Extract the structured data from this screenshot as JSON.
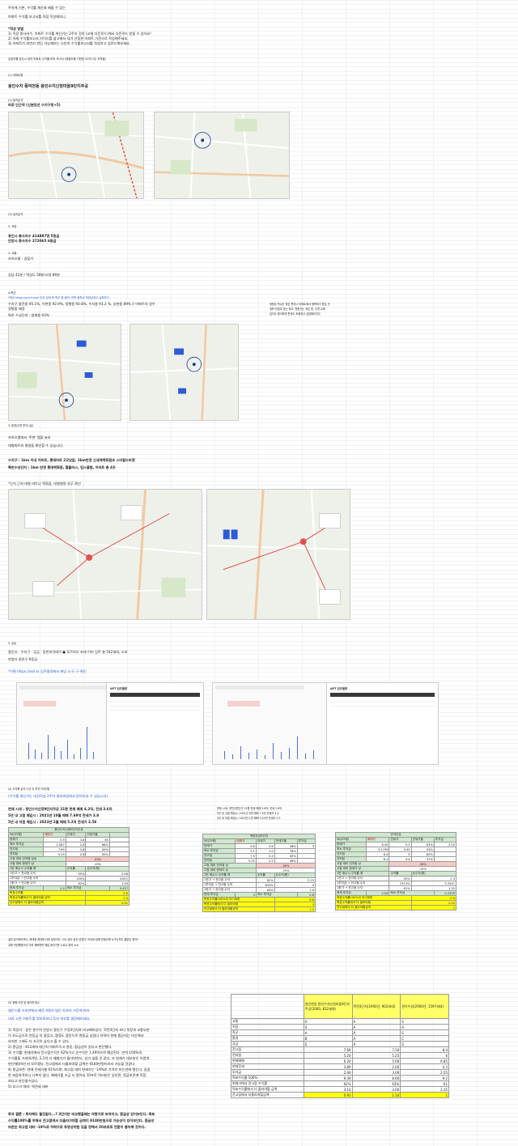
{
  "header": {
    "line1": "주차에 기본, 수익률 계산표 배울 수 있는",
    "line2": "아파트 수익률 보고서를 직접 작성해보니"
  },
  "rules": {
    "title": "*작성 방법",
    "r1": "1) 직장 종사자수, 아파트 수익률 계산기는 2주차 강의 (교재 다운로드)에서 다운로드 받을 수 있어요!",
    "r2": "2) 아래 수익률보고서 가이드를 참고해서 내가 선정한 아파트 기준으로 작성해주세요.",
    "r3": "3) 아파트가 비번지 판단 가능해보는 나만의 수익률보고서를 작성하고 업로드해보세요.",
    "note": "임장지를 앞두시 대자 아파트 수익률 보여 보고서 (정렬도를 기반한 20개 2주 지역별)"
  },
  "s1": {
    "tag": "(1) 아파트명",
    "name": "용인수지 풍덕천동 용인수지신정마을9단지주공"
  },
  "s2": {
    "tag": "(2) 위치분석",
    "line": "바로 인근역 (신분당선 수지구청+5)"
  },
  "s3": {
    "tag": "(3) 입지분석"
  },
  "s4": {
    "tag": "3. 직장",
    "l1": "용인시 총사자수 414887명 5등급",
    "l2": "안양시 종사자수 272065 6등급",
    "c": "2. 교통",
    "c2": "카카오맵 - 길찾기",
    "c3": "강남 42분 / 역삼도 58분/시청 86분"
  },
  "s5": {
    "tag": "4.학군",
    "link": "*학군 https://asil.kr/asil 단지 검색 후 학군 탭 클릭, 진학 중학교 학업성취도 살펴보기",
    "l1": "수지구 졸진중 95.1%, 이현중 92.9%, 정평중 92.8%, 수지중 91.2 %, 상현중 89% // 아파트의 경우",
    "l2": "정평중 배정",
    "l3": "특반 수성단지 : 범계중 93%",
    "side1": "정평은 학교는 좋은 편이나 아파트에서 왕복하기 좋은 곳",
    "side2": "생활 반경과 맞는 학교. 학원가는 적은 편. 주변 교육",
    "side3": "입지도 평이하며 편의도 조용하고 성장해보인다"
  },
  "s6": {
    "tag": "5. 환경(주변 편의시설)",
    "l1": "카카오맵에서 '주변' 탭을 눌러",
    "l2": "대형마트와 병원을 확인할 수 있습니다.",
    "l3": "수지구 : 1km 이내 이마트, 롯데마트 2곳있음, 2km반경 신세계백화점과 스타필드마켓",
    "l4": "특반수성단지 : 1km 반경 롯데백화점, 홈플러스, 킴스클럽, 이마트 총 4곳",
    "l5": "*단지 근처 대형 마트나 백화점, 대형병원 유무 확인"
  },
  "s7": {
    "tag": "5. 공급",
    "l1": "용인시 · 수지구 · 공급 · 동천지이데이 ● 푸르지오 포레 이미 입주 총 542세대, 소보",
    "l2": "안양시 동안구 6등급",
    "link": "*이편 https://asil.kr 입주물량에서 해당 시·도·구 확인"
  },
  "screens": {
    "t1": "APT 입주물량",
    "t2": "APT 입주물량"
  },
  "s8": {
    "tag": "(4) 수익률 분석 (1년 뒤 투자 가치/재)",
    "sub": "(수익률 계산기는 내강의실 2주차 첨부파일에서 받아보실 수 있습니다)",
    "l1": "현재 시세 : 용인수지신정9단지주공 21평 현재 매매 4.2억, 전세 3.6억",
    "l2": "5년 내 고점 매입시 : 2021년 10월 매매 7.69억 전세가 3.8",
    "l3": "5년 내 저점 매입시 : 2023년 2월 매매 5.2억 전세가 2.58",
    "side": "현재 시세: 부천신만단지 21평 현재 매매 5.6억, 전세 2.6억",
    "side2": "5년 내 고점 매입시: 2021년 9월 매매 7.5억 전세가 2.4",
    "side3": "5년 내 저점 매입시: 2023년 1월 매매 5.25억 전세가 2.5"
  },
  "tables": {
    "t1": {
      "title": "용인수지신정9단지주공",
      "h": [
        "58(25평)",
        "매매가",
        "전세가",
        "전세가율"
      ],
      "rows": [
        [
          "현재가",
          "5.9",
          "3.8",
          "65"
        ],
        [
          "최소 투자금",
          "2.087",
          "2.6",
          "86%"
        ],
        [
          "전고점",
          "7.69",
          "3.8",
          "49%"
        ],
        [
          "전저점",
          "5.25",
          "2.6",
          "50%"
        ]
      ],
      "k1": "고점 대비 전저점 상승",
      "v1": "-33%",
      "k2": "고점 대비 현재가 상",
      "v2": "-19%",
      "m1": "1번 매수시 수익률 예",
      "m2": "수익률",
      "m3": "순수익(원)",
      "r1": [
        "1전고 → 전고점 수익",
        "95%",
        "2.48"
      ],
      "r2": [
        "1투자금 → 전고점 수익",
        "100%",
        "4.651"
      ],
      "r3": [
        "1현가 → 전고점 수익",
        "62%",
        "1.49"
      ],
      "f1": [
        "현재 투자금",
        "2.4",
        "최소 투자금",
        "0.437"
      ],
      "y1": [
        "목표수익률",
        "0.6"
      ],
      "y2": [
        "목표수익률에서 더 올라야할 금액",
        "2.4"
      ],
      "y3": [
        "전고점에서 더 올라야할금액",
        "0.91"
      ]
    },
    "t2": {
      "title": "목련우성3단지",
      "h": [
        "58(25평)",
        "매매가",
        "전세가",
        "전세가율"
      ],
      "rows": [
        [
          "현재가",
          "5.6",
          "2.6",
          "46%"
        ],
        [
          "최소 투자금",
          "2.1",
          "1.9",
          "76%"
        ],
        [
          "전고점",
          "7.5",
          "2.4",
          "45%"
        ],
        [
          "전저점",
          "5.25",
          "2.5",
          "46%"
        ]
      ],
      "k1": "고점 대비 전저점 상",
      "v1": "-30%",
      "k2": "고점 대비 현재가 상",
      "v2": "-25%",
      "m1": "1번 매수시 수익률 예",
      "m2": "수익률",
      "m3": "순수익(원)",
      "r1": [
        "1전고 → 전고점 수익",
        "82%",
        "2.25"
      ],
      "r2": [
        "1투자금 → 전고점 수익",
        "833%",
        "5"
      ],
      "r3": [
        "1현가 → 전고점 수익",
        "63%",
        "1.9"
      ],
      "f1": [
        "현재 투자금",
        "3",
        "최소 투자금",
        "0.6"
      ],
      "y1": [
        "목표수익률100%이 되기위한",
        "8.6"
      ],
      "y2": [
        "목표수익률에서 더 올라야할",
        "3"
      ],
      "y3": [
        "전고점에서 더 올라야할금액",
        "1.1"
      ],
      "extra": "투자금",
      "extra2": "3"
    },
    "t3": {
      "title": "관악우성",
      "h": [
        "58(25평)",
        "매매가",
        "전세가",
        "전세가율"
      ],
      "rows": [
        [
          "현재가",
          "8.45",
          "5.3",
          "63%"
        ],
        [
          "최소 투자금",
          "3.1799",
          "3.95",
          "93%"
        ],
        [
          "전고점",
          "8.4",
          "5",
          "60%"
        ],
        [
          "전저점",
          "6.1",
          "3.4",
          "57%"
        ]
      ],
      "k1": "고점 대비 전저점 상",
      "v1": "-28%",
      "k2": "고점 대비 현재가 상",
      "v2": "-15%",
      "m1": "1번 매수시 수익률 예",
      "m2": "수익률",
      "m3": "순수익(원)",
      "r1": [
        "1전고 → 전고점 수익",
        "92%",
        "2.4"
      ],
      "r2": [
        "1투자금 → 전고점 수익",
        "2313%",
        "5.3241"
      ],
      "r3": [
        "1현가 → 전고점 수익",
        "61%",
        "1.55"
      ],
      "f1": [
        "현재 투자금",
        "2.55",
        "최소 투자금",
        "0.2259"
      ],
      "y1": [
        "목표수익률100%이 되기위한",
        "9.4"
      ],
      "y2": [
        "목표수익률에서 더 올라야할",
        "2.55"
      ],
      "y3": [
        "전고점에서 더 올라야할금액",
        "1"
      ],
      "extra": "투자금",
      "extra2": "2.55"
    }
  },
  "s9": {
    "l1": "실전 분석하다보니, 최대한 최대한 다한 분당지도, 나는 생고 싶지 않았다, 이유와 답해 부동산에 누구는지도 결론은 생각?",
    "l2": "교육 작성했었어서 이를 체화하면 매일 생각기를 누로수 정리 ★★"
  },
  "s10": {
    "tag": "(5) 종합 의견 및 정리할 점수",
    "h1": "앱은스를 기초반에서 배운 4절의 많은 투자의 기준에 따라",
    "h2": "내가 고른 아파트를 정보화보다 투자 여부를 결정해보세요.",
    "p1": "1) 직장가 : 같은 종수의 안양시 용인구 수정3단지와 비교해보았다. 목련3단지 보다 직장과 교통부분",
    "p2": "이 조도급으로 연동급 더 좋았고, 환경도 용인으로 편동급 낫었다 지역의 현재 평균지는 비슷해서",
    "p3": "하지만 그래도 더 조건이 남다고 볼 수 있다.",
    "p4": "2) 환금성 : 812세대 대단지 아파트이고 중동, 환금성이 있다고 판단했다.",
    "p5": "3) 수익률: 현재가에서 전고점수익은 62%이고 순수익은 1.49억으로 예상된다. 만약 100%의",
    "p6": "수익률을 기대하려면, 2.1억 더 매매가가 올라야한다. 성기 않을 것 같다. 또 현재가 대부분은 어렵게",
    "p7": "판단해야하는지 모르겠다. 전고점에서 더올라야할 금액은 9100만원이라서 가능할 것같다",
    "p8": "4) 원금보존: 현재 전세가율 61%이며, 최고점 대비 현재가는 -19%로 가격이 미는만에 됐는다, 꼼꼼",
    "p9": "한 싸움하려하니 나쁘지 않다. 매매가를 조금 더 떨어서 10프로 여러분은 있다면, 원금보존에 적합",
    "p10": "하다고 판단될수있다.",
    "p11": "5) 리스크 대비: 역전세 대비",
    "c1": "투자 결론 : 투자해도 될것같다...? 3단지만 비교했을때는 저평가로 보여지고, 환금성 있어보인다. 목표",
    "c2": "수익률100%를 위해서 전고점에서 더올라가야할 금액이 9100만원으로 가능성이 있어보인다. 환금성",
    "c3": "보존은 최고점 대비 -19%로 하락으로 투명성위험 있을 정해서 20프로로 전환이 좋아해 것이다."
  },
  "compare": {
    "h": [
      "",
      "용인천동 용인수지신정마을9단지주공(2000, 812세대)",
      "목련3단지(1992년, 902세대)",
      "관악우성(2000년, 1597세대)"
    ],
    "rows": [
      [
        "교통",
        "A",
        "A",
        "S"
      ],
      [
        "직장",
        "S",
        "A",
        "A"
      ],
      [
        "학군",
        "A",
        "A",
        "S"
      ],
      [
        "환경",
        "B",
        "A",
        "C"
      ],
      [
        "공급",
        "S",
        "A",
        "S"
      ],
      [
        "전고점",
        "7.69",
        "7.50",
        "8.4"
      ],
      [
        "전저점",
        "5.20",
        "5.25",
        "6"
      ],
      [
        "현재매매",
        "6.20",
        "5.60",
        "6.85"
      ],
      [
        "현재전세",
        "3.80",
        "2.60",
        "4.3"
      ],
      [
        "투자금",
        "2.40",
        "3.00",
        "2.55"
      ],
      [
        "목표수익률 100%",
        "9.30",
        "8.60",
        "9.2"
      ],
      [
        "현재가에서 전고점 수익률",
        "62%",
        "63%",
        "61"
      ],
      [
        "목표수익률에서 더 올라야할 금액",
        "3.10",
        "3.00",
        "2.35"
      ],
      [
        "전고점에서 더올라야할금액",
        "0.91",
        "1.10",
        "1"
      ]
    ]
  }
}
